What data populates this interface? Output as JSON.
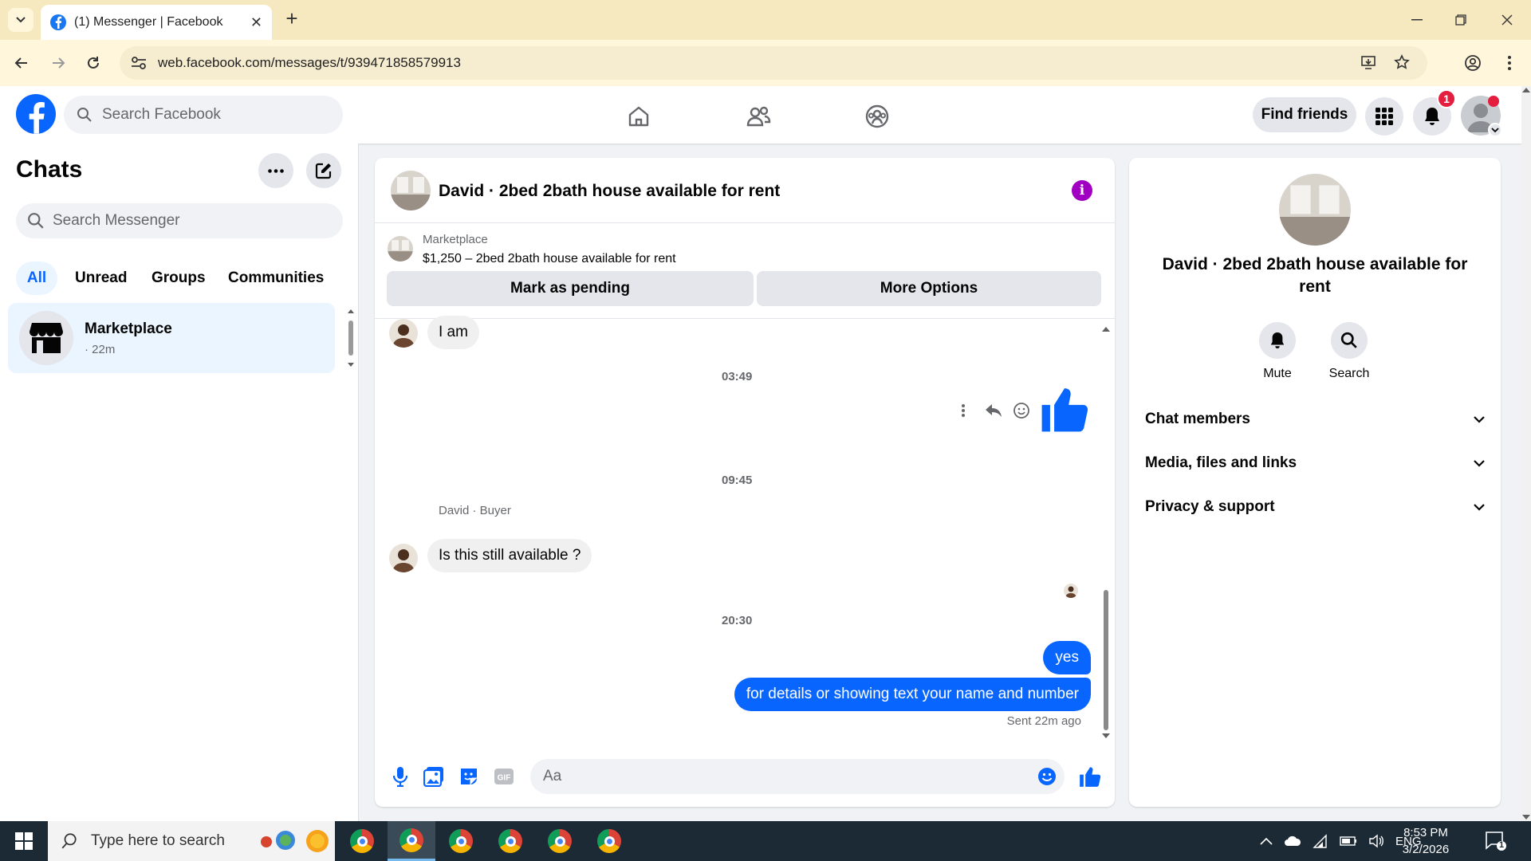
{
  "browser": {
    "tab_title": "(1) Messenger | Facebook",
    "url": "web.facebook.com/messages/t/939471858579913"
  },
  "fb_nav": {
    "search_placeholder": "Search Facebook",
    "find_friends": "Find friends",
    "notification_count": "1"
  },
  "chats": {
    "title": "Chats",
    "search_placeholder": "Search Messenger",
    "filters": [
      "All",
      "Unread",
      "Groups",
      "Communities"
    ],
    "active_filter": "All",
    "items": [
      {
        "name": "Marketplace",
        "time": "· 22m"
      }
    ]
  },
  "conversation": {
    "title": "David · 2bed 2bath house available for rent",
    "marketplace_label": "Marketplace",
    "listing": "$1,250 – 2bed 2bath house available for rent",
    "buttons": {
      "pending": "Mark as pending",
      "more": "More Options"
    },
    "messages": {
      "in_1": "I am",
      "time_1": "03:49",
      "time_2": "09:45",
      "sender_2": "David · Buyer",
      "in_2": "Is this still available ?",
      "time_3": "20:30",
      "out_1": "yes",
      "out_2": "for details or showing text your name and number",
      "sent_status": "Sent 22m ago"
    },
    "composer_placeholder": "Aa"
  },
  "info_panel": {
    "name": "David · 2bed 2bath house available for rent",
    "actions": [
      "Mute",
      "Search"
    ],
    "sections": [
      "Chat members",
      "Media, files and links",
      "Privacy & support"
    ]
  },
  "taskbar": {
    "search_placeholder": "Type here to search",
    "language": "ENG",
    "time": "8:53 PM",
    "date": "3/2/2026",
    "notification_count": "1"
  },
  "colors": {
    "accent": "#0866ff",
    "bubble_out": "#0866ff",
    "info_icon": "#a100c2",
    "badge": "#e41e3f"
  }
}
